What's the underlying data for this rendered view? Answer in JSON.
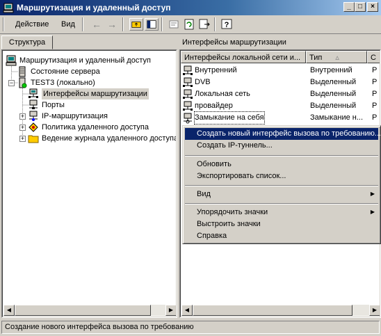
{
  "window": {
    "title": "Маршрутизация и удаленный доступ",
    "minimize": "_",
    "maximize": "□",
    "close": "×"
  },
  "menu": {
    "action": "Действие",
    "view": "Вид"
  },
  "left": {
    "tab": "Структура",
    "tree": [
      {
        "label": "Маршрутизация и удаленный доступ",
        "icon": "computer-icon"
      },
      {
        "label": "Состояние сервера",
        "icon": "server-status-icon"
      },
      {
        "label": "TEST3 (локально)",
        "icon": "server-icon"
      },
      {
        "label": "Интерфейсы маршрутизации",
        "icon": "network-interfaces-icon"
      },
      {
        "label": "Порты",
        "icon": "ports-icon"
      },
      {
        "label": "IP-маршрутизация",
        "icon": "ip-routing-icon"
      },
      {
        "label": "Политика удаленного доступа",
        "icon": "policy-icon"
      },
      {
        "label": "Ведение журнала удаленного доступа",
        "icon": "folder-icon"
      }
    ]
  },
  "right": {
    "header": "Интерфейсы маршрутизации",
    "columns": [
      "Интерфейсы локальной сети и...",
      "Тип",
      "С"
    ],
    "rows": [
      {
        "name": "Внутренний",
        "type": "Внутренний",
        "status": "Р"
      },
      {
        "name": "DVB",
        "type": "Выделенный",
        "status": "Р"
      },
      {
        "name": "Локальная сеть",
        "type": "Выделенный",
        "status": "Р"
      },
      {
        "name": "провайдер",
        "type": "Выделенный",
        "status": "Р"
      },
      {
        "name": "Замыкание на себя",
        "type": "Замыкание н...",
        "status": "Р"
      }
    ]
  },
  "context_menu": {
    "items": [
      "Создать новый интерфейс вызова по требованию...",
      "Создать IP-туннель...",
      "Обновить",
      "Экспортировать список...",
      "Вид",
      "Упорядочить значки",
      "Выстроить значки",
      "Справка"
    ]
  },
  "status": "Создание нового интерфейса вызова по требованию",
  "colors": {
    "titlebar": "#0a246a",
    "highlight": "#0a246a",
    "face": "#d4d0c8"
  }
}
